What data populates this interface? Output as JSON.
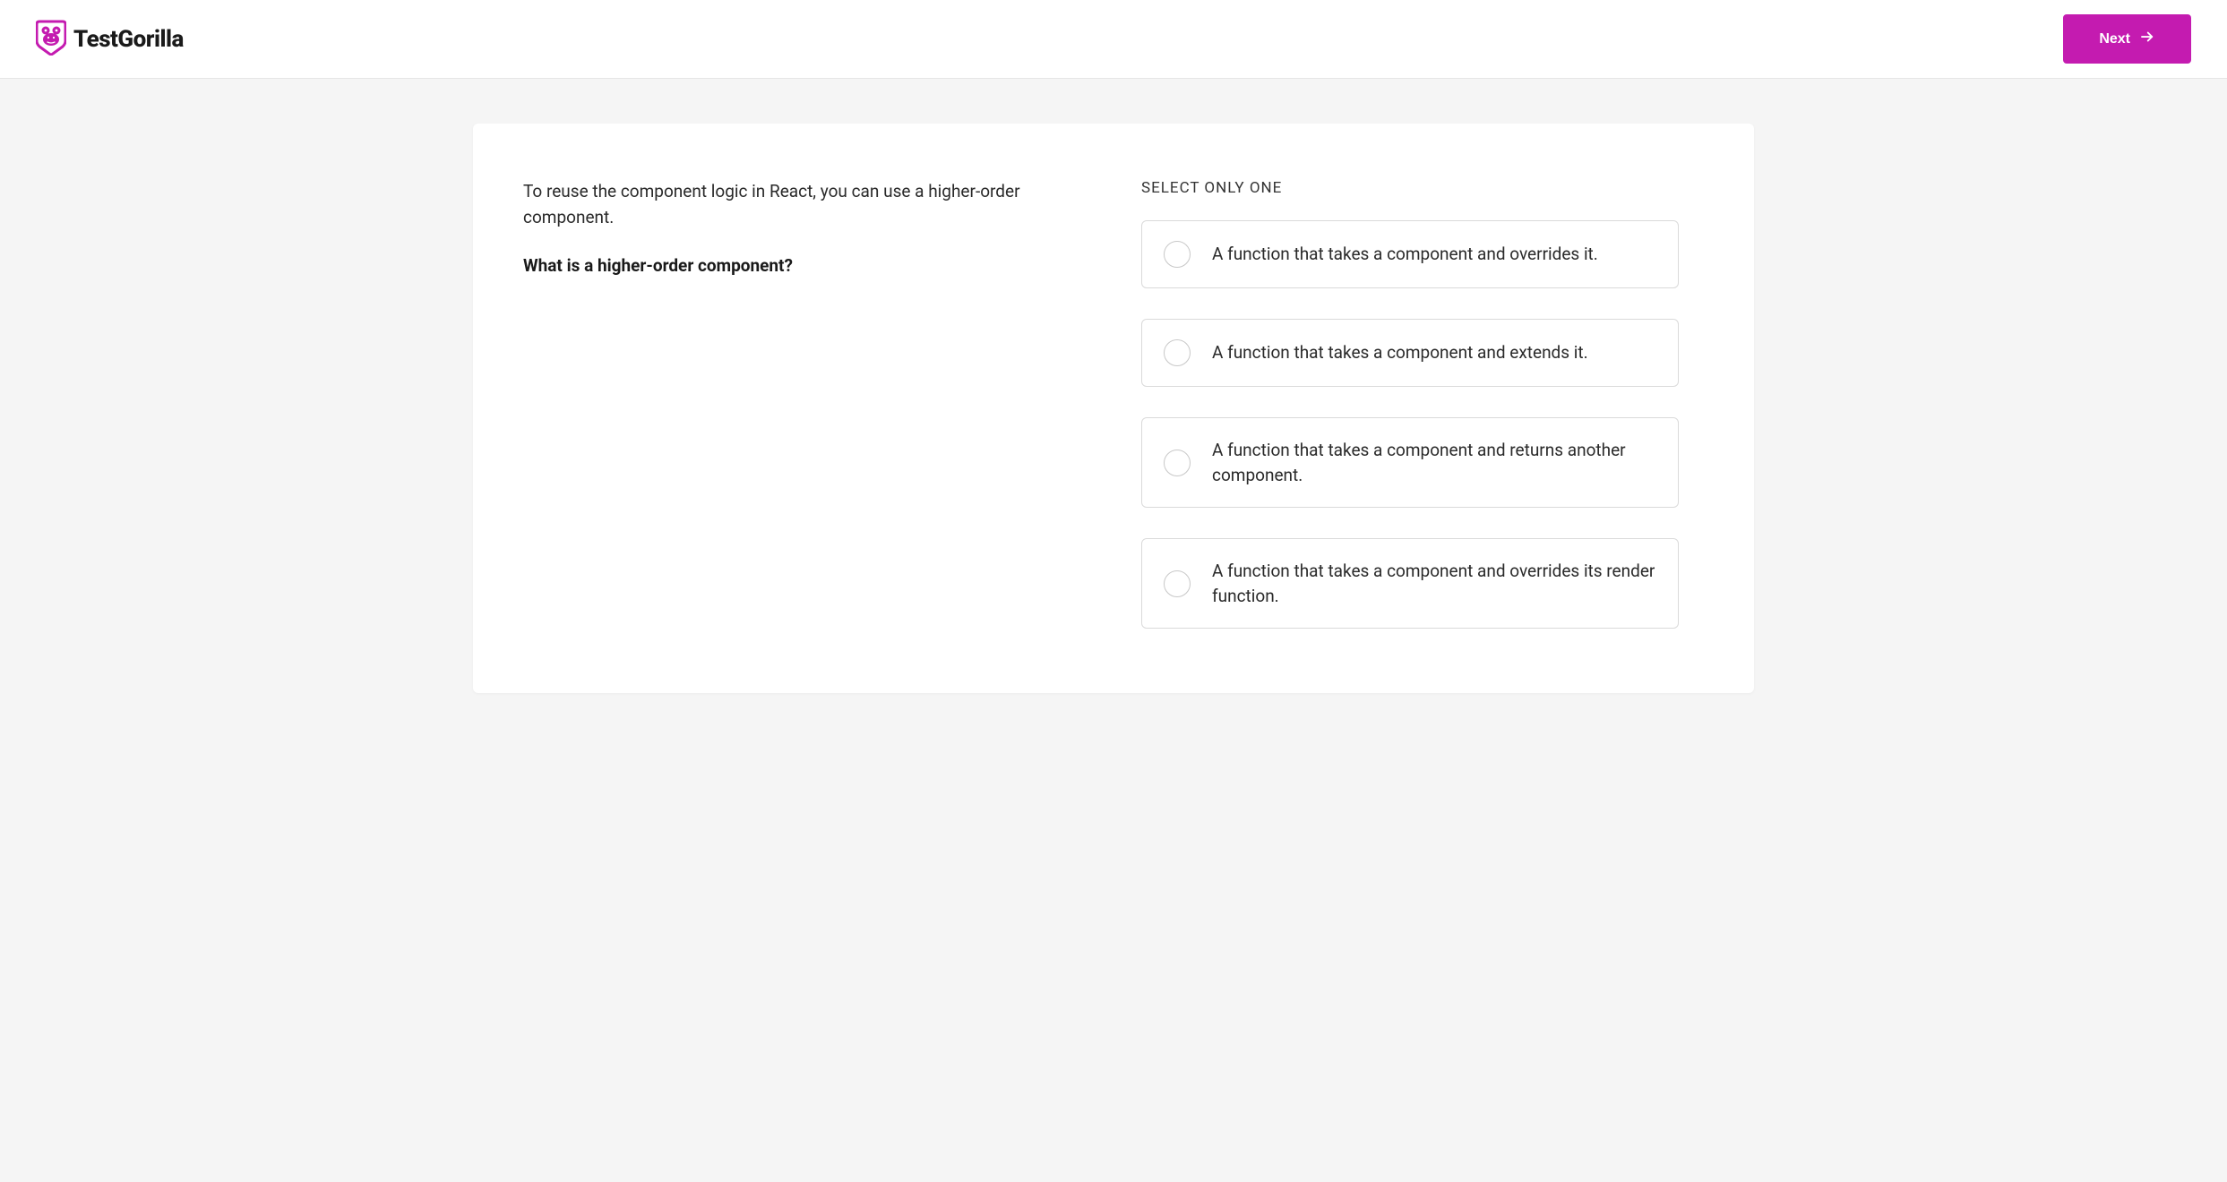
{
  "header": {
    "brand_name": "TestGorilla",
    "next_button_label": "Next"
  },
  "question": {
    "intro_text": "To reuse the component logic in React, you can use a higher-order component.",
    "prompt_text": "What is a higher-order component?"
  },
  "options": {
    "instruction": "SELECT ONLY ONE",
    "items": [
      {
        "label": "A function that takes a component and overrides it."
      },
      {
        "label": "A function that takes a component and extends it."
      },
      {
        "label": "A function that takes a component and returns another component."
      },
      {
        "label": "A function that takes a component and overrides its render function."
      }
    ]
  },
  "colors": {
    "accent": "#c41bb0"
  }
}
